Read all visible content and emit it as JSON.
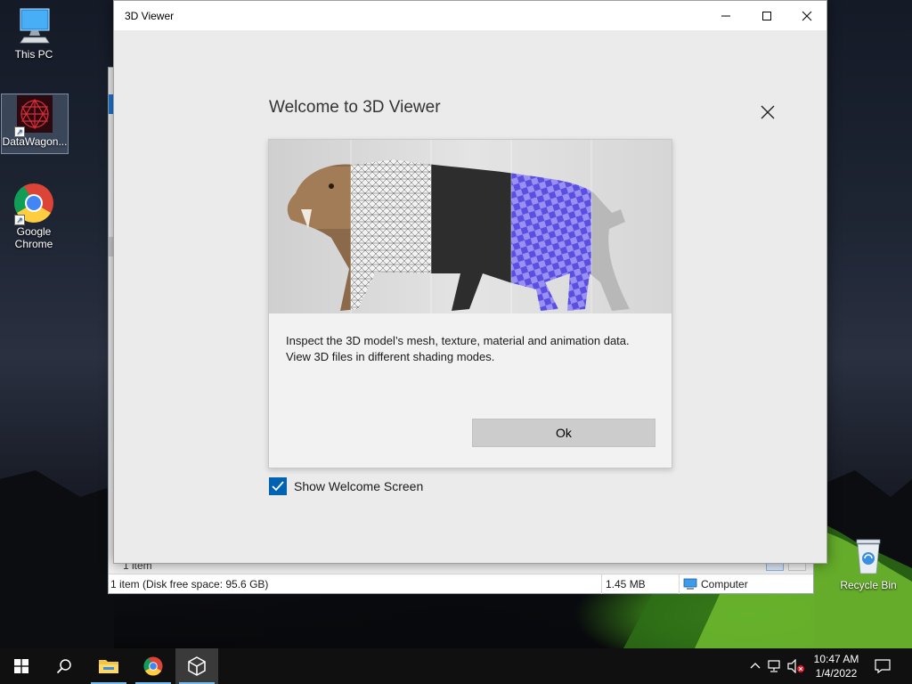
{
  "desktop": {
    "icons": [
      {
        "label": "This PC",
        "icon": "computer-icon"
      },
      {
        "label": "DataWagon...",
        "icon": "datawagon-logo-icon"
      },
      {
        "label": "Google Chrome",
        "icon": "chrome-icon"
      },
      {
        "label": "Recycle Bin",
        "icon": "recycle-bin-icon"
      }
    ]
  },
  "explorer": {
    "items_label": "1 item",
    "status": {
      "items": "1 item (Disk free space: 95.6 GB)",
      "size": "1.45 MB",
      "location": "Computer"
    }
  },
  "viewer": {
    "title": "3D Viewer",
    "welcome": {
      "heading": "Welcome to 3D Viewer",
      "description_line1": "Inspect the 3D model’s mesh, texture, material and animation data.",
      "description_line2": "View 3D files in different shading modes.",
      "ok_label": "Ok",
      "show_welcome_label": "Show Welcome Screen",
      "show_welcome_checked": true
    }
  },
  "taskbar": {
    "buttons": [
      "start-icon",
      "search-icon",
      "file-explorer-icon",
      "chrome-icon",
      "3d-viewer-icon"
    ],
    "active": "3d-viewer-icon",
    "clock": {
      "time": "10:47 AM",
      "date": "1/4/2022"
    }
  },
  "colors": {
    "accent": "#0063b1",
    "taskbar": "#101010",
    "ok_button": "#cccccc",
    "checker_blue": "#7b6ff0"
  }
}
